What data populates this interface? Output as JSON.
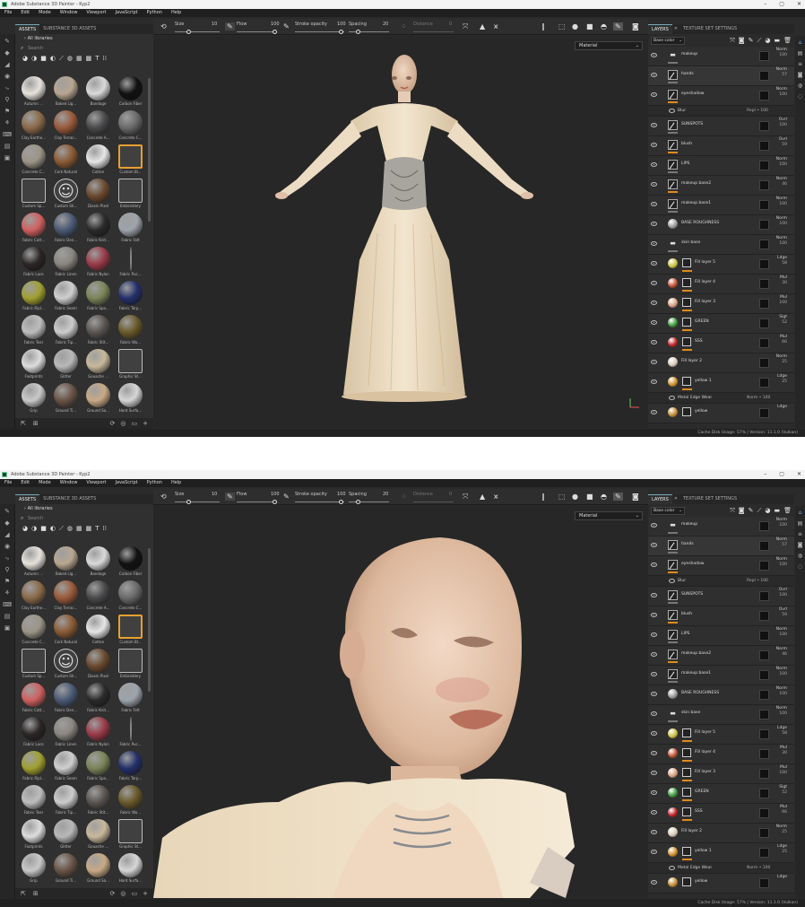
{
  "app": {
    "title": "Adobe Substance 3D Painter - Kyp2",
    "menu": [
      "File",
      "Edit",
      "Mode",
      "Window",
      "Viewport",
      "JavaScript",
      "Python",
      "Help"
    ],
    "window_buttons": [
      "–",
      "▢",
      "✕"
    ]
  },
  "assets": {
    "tabs": [
      "ASSETS",
      "SUBSTANCE 3D ASSETS"
    ],
    "all_libraries": "All libraries",
    "search_placeholder": "Search",
    "items": [
      {
        "label": "Autumn ...",
        "color": "#e7e2dc",
        "kind": "leaf"
      },
      {
        "label": "Baked Lig...",
        "color": "#b8a690"
      },
      {
        "label": "Bandage",
        "color": "#d9d9d9"
      },
      {
        "label": "Carbon Fiber",
        "color": "#111111"
      },
      {
        "label": "Clay Earthe...",
        "color": "#8b6a4a"
      },
      {
        "label": "Clay Terrac...",
        "color": "#9a5a3a"
      },
      {
        "label": "Concrete A...",
        "color": "#4a4a4c"
      },
      {
        "label": "Concrete C...",
        "color": "#6a6a6a"
      },
      {
        "label": "Concrete C...",
        "color": "#9b9587"
      },
      {
        "label": "Cork Natural",
        "color": "#8a5a34"
      },
      {
        "label": "Cotton",
        "color": "#e6e6e6"
      },
      {
        "label": "Custom Bl...",
        "color": "#404040",
        "kind": "sq-orange"
      },
      {
        "label": "Custom Sp...",
        "color": "#404040",
        "kind": "sq"
      },
      {
        "label": "Custom Sti...",
        "color": "#404040",
        "kind": "smile"
      },
      {
        "label": "Dioxin Pixel",
        "color": "#6a4a30"
      },
      {
        "label": "Embroidery",
        "color": "#404040",
        "kind": "sq"
      },
      {
        "label": "Fabric Cott...",
        "color": "#d06060"
      },
      {
        "label": "Fabric Den...",
        "color": "#4a5a74"
      },
      {
        "label": "Fabric Knit...",
        "color": "#2a2a2a"
      },
      {
        "label": "Fabric Felt",
        "color": "#9ea4ac"
      },
      {
        "label": "Fabric Lace",
        "color": "#2c2626"
      },
      {
        "label": "Fabric Linen",
        "color": "#8a8680"
      },
      {
        "label": "Fabric Nylon",
        "color": "#9a3a48"
      },
      {
        "label": "Fabric Puc...",
        "color": "#2a2a2a",
        "kind": "stick"
      },
      {
        "label": "Fabric Ripl...",
        "color": "#a0a030"
      },
      {
        "label": "Fabric Seam",
        "color": "#cfcfcf"
      },
      {
        "label": "Fabric Spa...",
        "color": "#7a8458"
      },
      {
        "label": "Fabric Tarp...",
        "color": "#23306a"
      },
      {
        "label": "Fabric Tear",
        "color": "#bdbdbd"
      },
      {
        "label": "Fabric Tip...",
        "color": "#cccccc"
      },
      {
        "label": "Fabric Stit...",
        "color": "#5a5450"
      },
      {
        "label": "Fabric Wo...",
        "color": "#6a5a2a"
      },
      {
        "label": "Footprints",
        "color": "#dddddd"
      },
      {
        "label": "Glitter",
        "color": "#b8b8b8"
      },
      {
        "label": "Gouache ...",
        "color": "#c8b89c"
      },
      {
        "label": "Graphic St...",
        "color": "#404040",
        "kind": "sq"
      },
      {
        "label": "Grip",
        "color": "#c9c9c9"
      },
      {
        "label": "Ground Ti...",
        "color": "#6a5446"
      },
      {
        "label": "Ground Sa...",
        "color": "#c8aa86"
      },
      {
        "label": "Hard Surfa...",
        "color": "#d6d6d6"
      },
      {
        "label": "",
        "color": "#e0e0e0"
      },
      {
        "label": "",
        "color": "#555555"
      },
      {
        "label": "",
        "color": "#777777"
      },
      {
        "label": "",
        "color": "#666666"
      }
    ]
  },
  "toolbar": {
    "size_label": "Size",
    "size_value": "10",
    "flow_label": "Flow",
    "flow_value": "100",
    "stroke_label": "Stroke opacity",
    "stroke_value": "100",
    "spacing_label": "Spacing",
    "spacing_value": "20",
    "distance_label": "Distance",
    "distance_value": "0"
  },
  "viewport": {
    "material_mode": "Material"
  },
  "layers": {
    "tabs": [
      "LAYERS",
      "TEXTURE SET SETTINGS"
    ],
    "channel": "Base color",
    "rows": [
      {
        "name": "makeup",
        "type": "folder",
        "blend": "Norm",
        "op": "100",
        "mark": "grey"
      },
      {
        "name": "hands",
        "type": "paint",
        "blend": "Norm",
        "op": "57",
        "sel": true,
        "mark": "grey"
      },
      {
        "name": "eyeshadow",
        "type": "paint",
        "blend": "Norm",
        "op": "100",
        "mark": "orange"
      },
      {
        "name": "Blur",
        "type": "sub",
        "blend": "Repl",
        "op": "100"
      },
      {
        "name": "SUNSPOTS",
        "type": "paint",
        "blend": "Ovrl",
        "op": "100",
        "mark": "grey"
      },
      {
        "name": "blush",
        "type": "paint",
        "blend": "Ovrl",
        "op": "59",
        "mark": "orange"
      },
      {
        "name": "LIPS",
        "type": "paint",
        "blend": "Norm",
        "op": "100",
        "mark": "grey"
      },
      {
        "name": "makeup base2",
        "type": "paint",
        "blend": "Norm",
        "op": "46",
        "mark": "orange"
      },
      {
        "name": "makeup base1",
        "type": "paint",
        "blend": "Norm",
        "op": "100",
        "mark": "grey"
      },
      {
        "name": "BASE ROUGHNESS",
        "type": "sphere",
        "color": "#9a9a9a",
        "blend": "Norm",
        "op": "100"
      },
      {
        "name": "skin base",
        "type": "folder",
        "blend": "Norm",
        "op": "100",
        "mark": "grey"
      },
      {
        "name": "Fill layer 5",
        "type": "fill",
        "color": "#c9c040",
        "blend": "Ldge",
        "op": "58",
        "mark": "orange"
      },
      {
        "name": "Fill layer 4",
        "type": "fill",
        "color": "#c05030",
        "blend": "Mul",
        "op": "30",
        "mark": "orange"
      },
      {
        "name": "Fill layer 3",
        "type": "fill",
        "color": "#d8a080",
        "blend": "Mul",
        "op": "100",
        "mark": "orange"
      },
      {
        "name": "GREEN",
        "type": "fill",
        "color": "#3a9a3a",
        "blend": "Slgt",
        "op": "52",
        "mark": "orange"
      },
      {
        "name": "SSS",
        "type": "fill",
        "color": "#c02020",
        "blend": "Mul",
        "op": "66",
        "mark": "orange"
      },
      {
        "name": "Fill layer 2",
        "type": "sphere",
        "color": "#d8cbb8",
        "blend": "Norm",
        "op": "25"
      },
      {
        "name": "yellow 1",
        "type": "fill",
        "color": "#d0902a",
        "blend": "Ldge",
        "op": "25",
        "mark": "orange"
      },
      {
        "name": "Metal Edge Wear",
        "type": "sub",
        "blend": "Norm",
        "op": "100"
      },
      {
        "name": "yellow",
        "type": "fill",
        "color": "#c08a30",
        "blend": "Ldge",
        "op": ""
      }
    ]
  },
  "status": "Cache Disk Usage: 57% | Version: 11.1.0 (Vulkan)"
}
